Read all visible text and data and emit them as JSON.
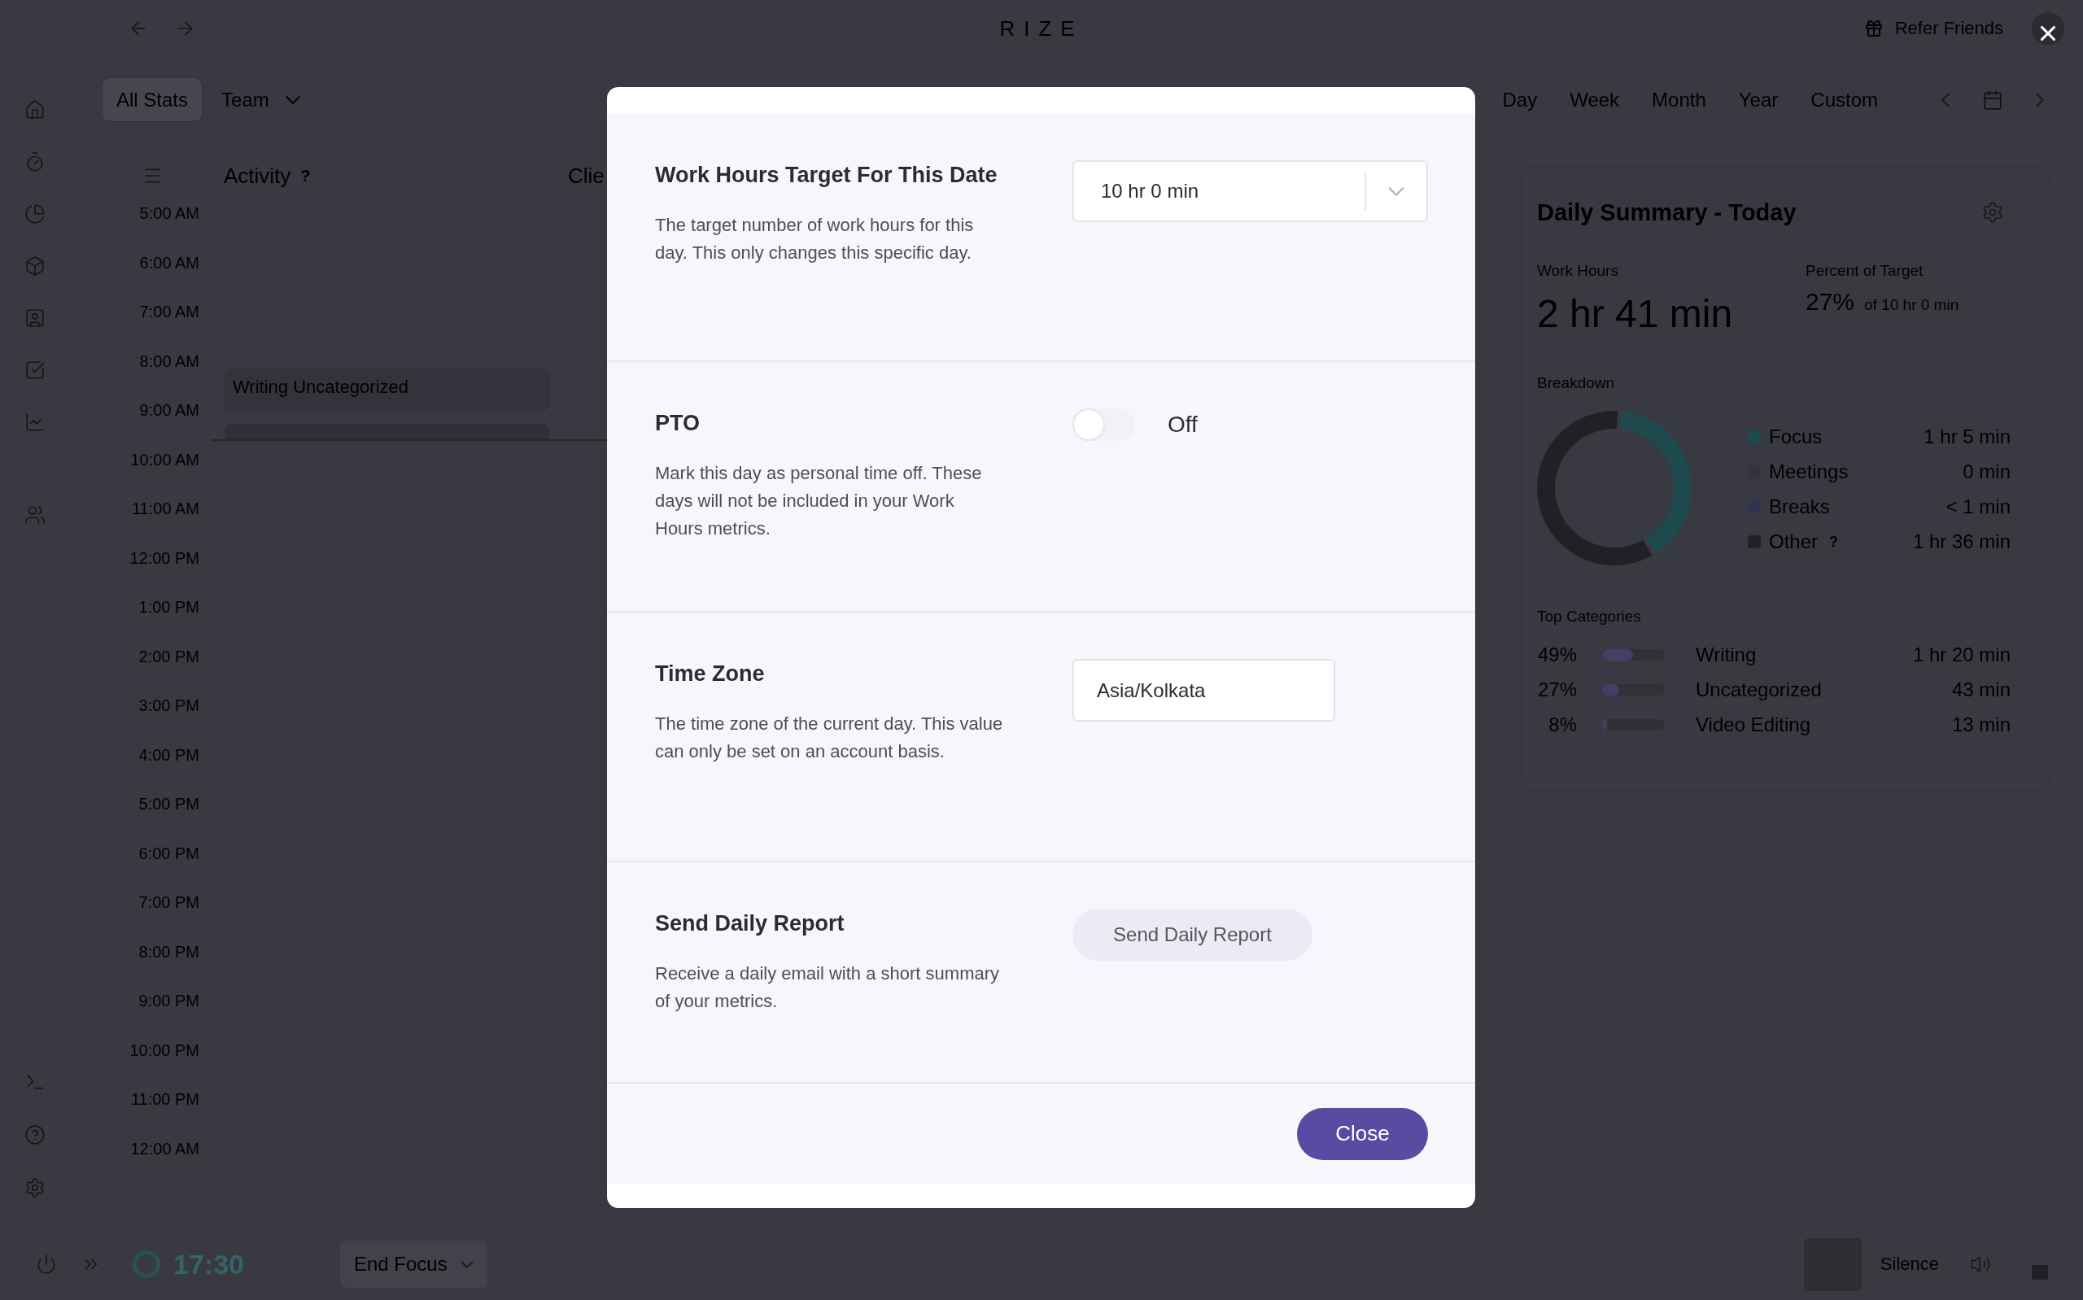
{
  "top_bar": {
    "logo": "RIZE",
    "refer_friends": "Refer Friends"
  },
  "view_tabs": [
    {
      "label": "All Stats",
      "selected": true
    }
  ],
  "team_dropdown": {
    "label": "Team"
  },
  "range_tabs": [
    "Day",
    "Week",
    "Month",
    "Year",
    "Custom"
  ],
  "timeline": {
    "heading": "Activity",
    "help": "?",
    "column_2_heading": "Clie",
    "hours": [
      "5:00 AM",
      "6:00 AM",
      "7:00 AM",
      "8:00 AM",
      "9:00 AM",
      "10:00 AM",
      "11:00 AM",
      "12:00 PM",
      "1:00 PM",
      "2:00 PM",
      "3:00 PM",
      "4:00 PM",
      "5:00 PM",
      "6:00 PM",
      "7:00 PM",
      "8:00 PM",
      "9:00 PM",
      "10:00 PM",
      "11:00 PM",
      "12:00 AM"
    ],
    "events": [
      {
        "kind": "labeled",
        "label": "Writing Uncategorized"
      },
      {
        "kind": "plain"
      }
    ]
  },
  "summary": {
    "title": "Daily Summary - Today",
    "work_hours": {
      "label": "Work Hours",
      "value": "2 hr 41 min"
    },
    "percent_of_target": {
      "label": "Percent of Target",
      "value": "27%",
      "note": "of 10 hr 0 min"
    },
    "breakdown": {
      "label": "Breakdown",
      "chart_data": {
        "type": "donut",
        "categories": [
          "Focus",
          "Meetings",
          "Breaks",
          "Other"
        ],
        "values": [
          40.4,
          0,
          0,
          59.6
        ]
      },
      "legend": [
        {
          "color": "#1e4a4e",
          "value": "1 hr 5 min"
        },
        {
          "color": "#37323f",
          "value": "0 min"
        },
        {
          "color": "#2d3550",
          "value": "< 1 min"
        },
        {
          "color": "#202025",
          "help": "?",
          "value": "1 hr 36 min"
        }
      ]
    },
    "top_categories": {
      "label": "Top Categories",
      "items": [
        {
          "percent": "49%",
          "level": 0.49,
          "name": "Writing",
          "time": "1 hr 20 min"
        },
        {
          "percent": "27%",
          "level": 0.27,
          "name": "Uncategorized",
          "time": "43 min"
        },
        {
          "percent": "8%",
          "level": 0.08,
          "name": "Video Editing",
          "time": "13 min"
        }
      ]
    }
  },
  "modal": {
    "settings": [
      {
        "kind": "select",
        "title": "Work Hours Target For This Date",
        "description": "The target number of work hours for this day. This only changes this specific day.",
        "value": "10 hr 0 min"
      },
      {
        "kind": "toggle",
        "title": "PTO",
        "description": "Mark this day as personal time off. These days will not be included in your Work Hours metrics.",
        "on": false,
        "state_label": "Off"
      },
      {
        "kind": "input",
        "title": "Time Zone",
        "description": "The time zone of the current day. This value can only be set on an account basis.",
        "value": "Asia/Kolkata"
      },
      {
        "kind": "button",
        "title": "Send Daily Report",
        "description": "Receive a daily email with a short summary of your metrics.",
        "button": "Send Daily Report"
      }
    ],
    "close_button": "Close"
  },
  "bottom_bar": {
    "timer": "17:30",
    "end_focus": "End Focus",
    "silence": "Silence"
  }
}
